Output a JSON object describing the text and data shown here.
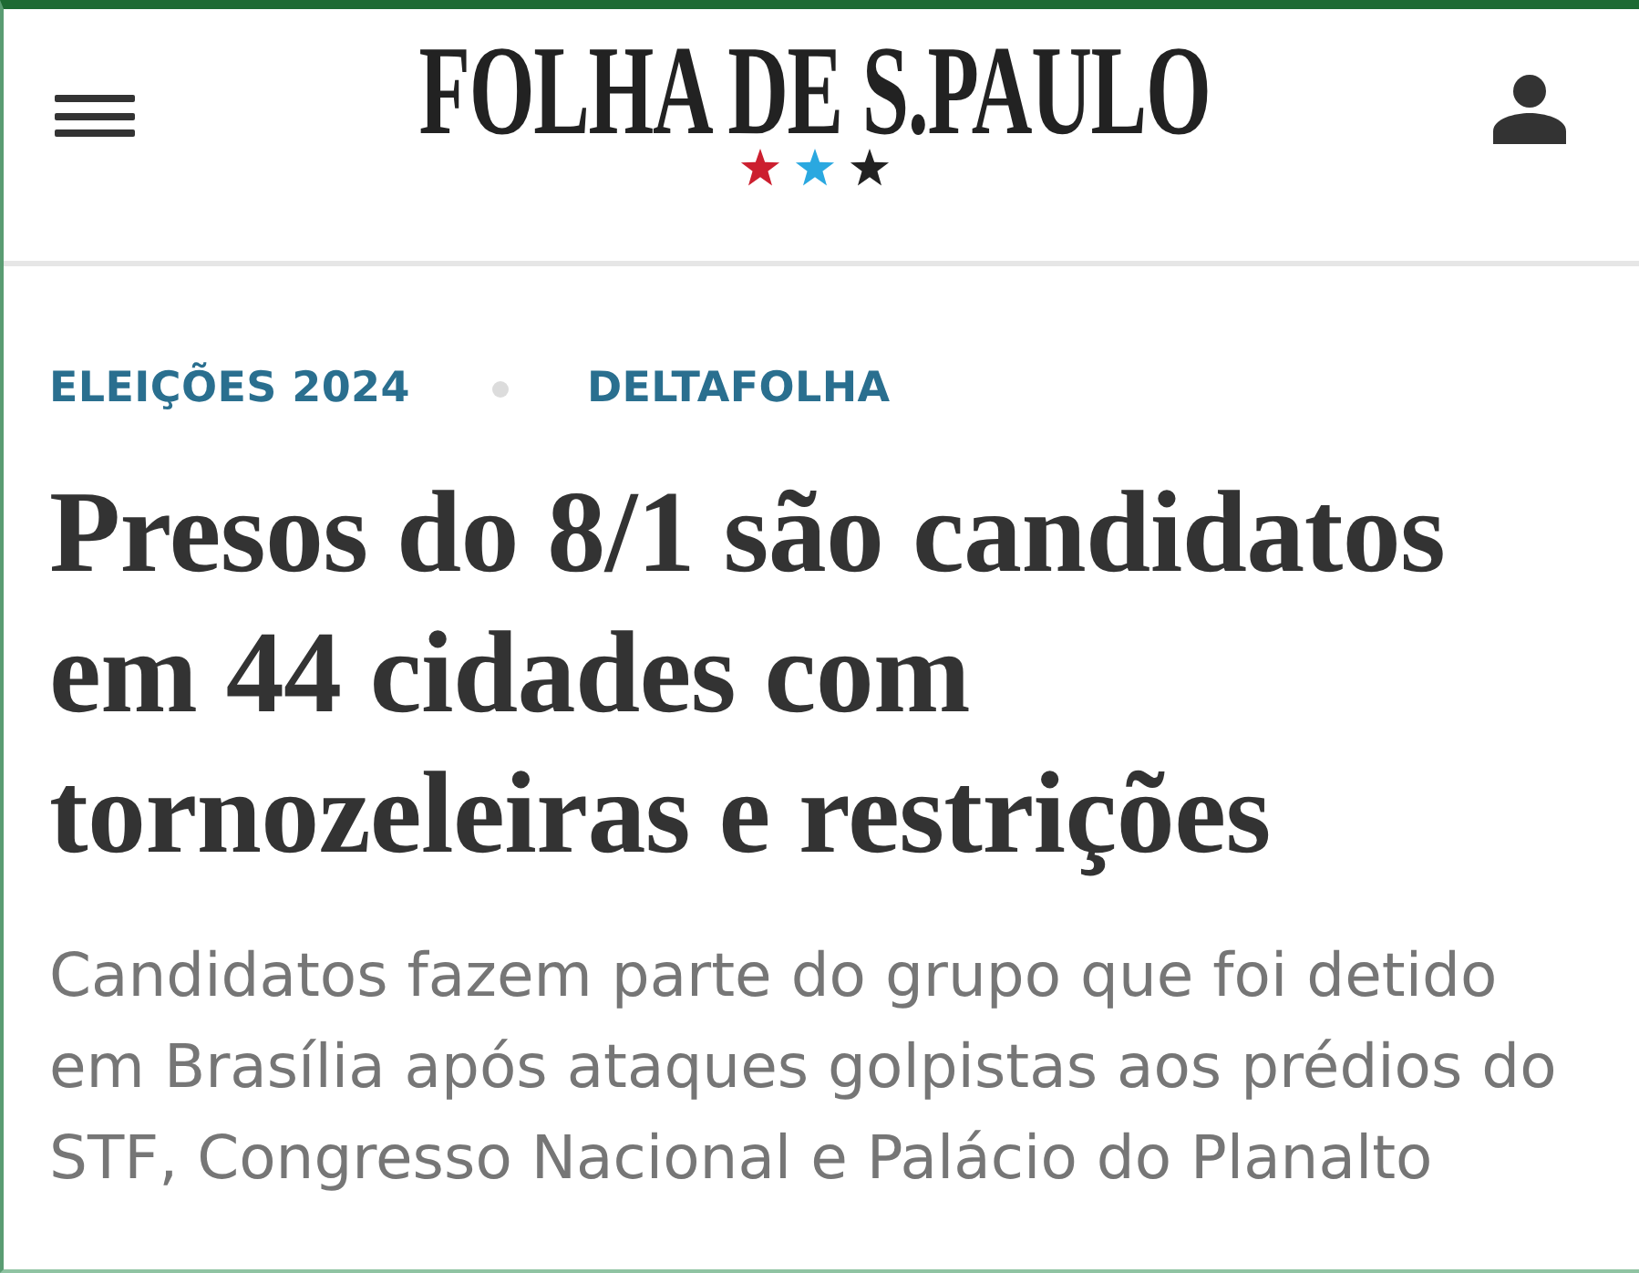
{
  "header": {
    "logo": "FOLHA DE S.PAULO",
    "stars": [
      {
        "color": "#cc1f2f"
      },
      {
        "color": "#2aa8e0"
      },
      {
        "color": "#222222"
      }
    ]
  },
  "tags": [
    "ELEIÇÕES 2024",
    "DELTAFOLHA"
  ],
  "headline": "Presos do 8/1 são candidatos em 44 cidades com tornozeleiras e restrições",
  "subtitle": "Candidatos fazem parte do grupo que foi detido em Brasília após ataques golpistas aos prédios do STF, Congresso Nacional e Palácio do Planalto"
}
